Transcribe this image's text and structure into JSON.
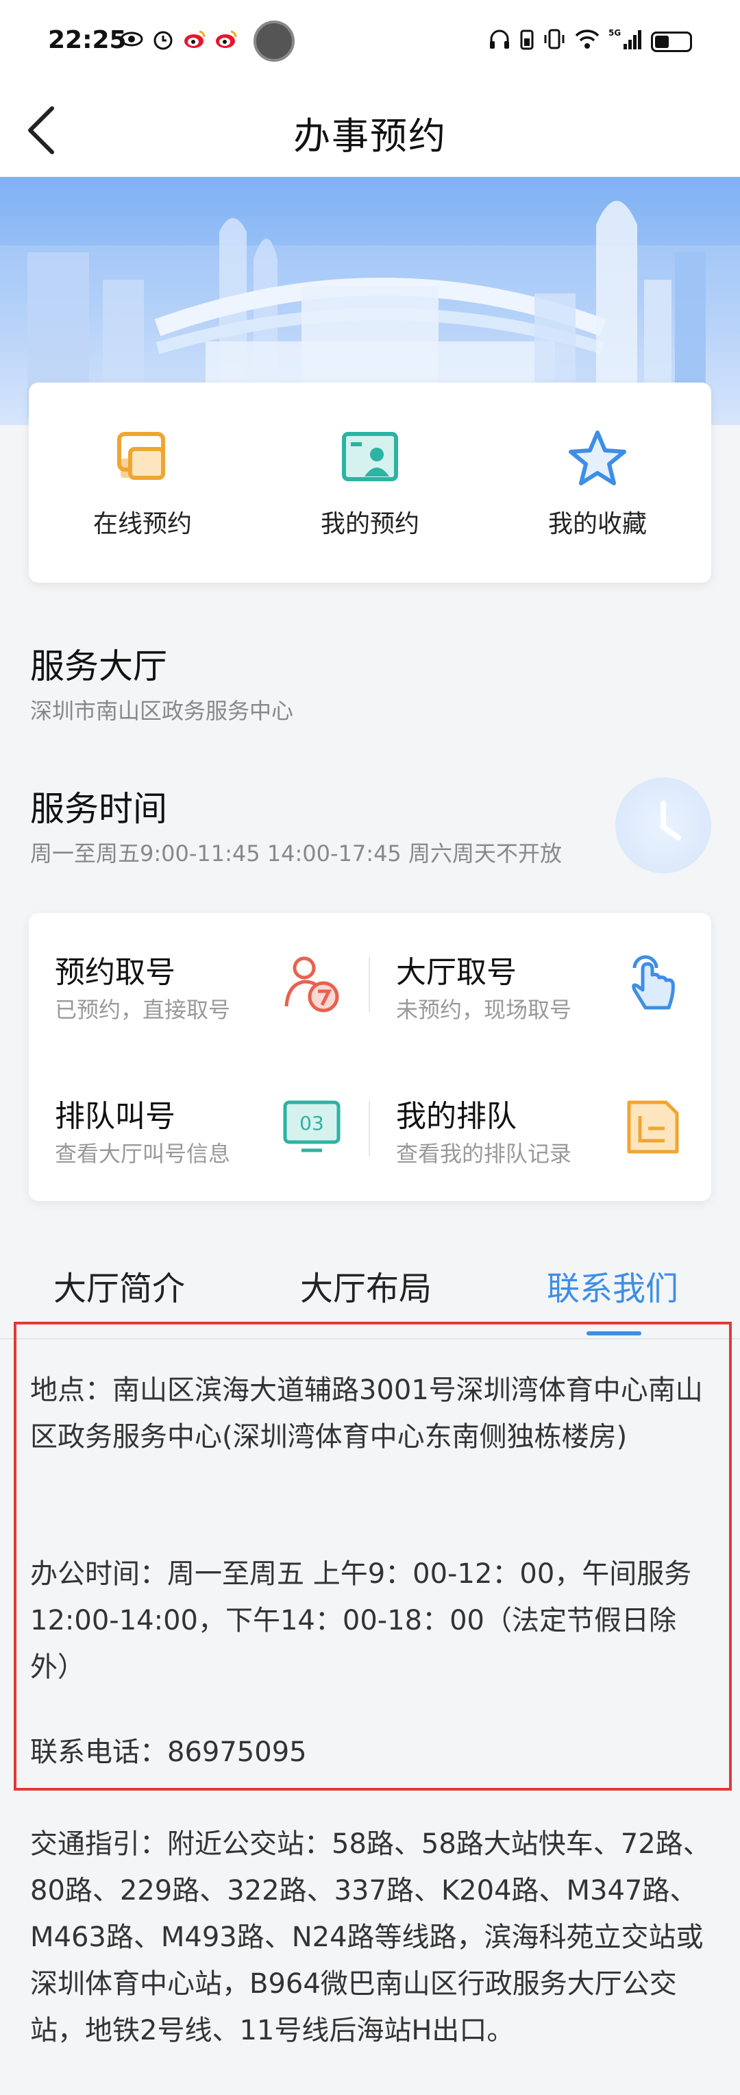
{
  "status_bar": {
    "time": "22:25",
    "left_icons": [
      "eye-icon",
      "alarm-icon",
      "weibo-icon",
      "weibo-icon"
    ],
    "right_icons": [
      "headphones-icon",
      "battery-saver-icon",
      "vibrate-icon",
      "wifi-icon",
      "signal-5g-icon",
      "battery-icon"
    ]
  },
  "nav": {
    "title": "办事预约"
  },
  "quick_actions": [
    {
      "label": "在线预约",
      "icon": "online-booking-icon",
      "color": "#f0a531"
    },
    {
      "label": "我的预约",
      "icon": "my-booking-icon",
      "color": "#2bb3a3"
    },
    {
      "label": "我的收藏",
      "icon": "favorite-star-icon",
      "color": "#3d8ee6"
    }
  ],
  "hall": {
    "title": "服务大厅",
    "name": "深圳市南山区政务服务中心"
  },
  "service_time": {
    "title": "服务时间",
    "hours": "周一至周五9:00-11:45 14:00-17:45 周六周天不开放"
  },
  "queue": [
    {
      "title": "预约取号",
      "sub": "已预约，直接取号",
      "icon": "booked-number-icon",
      "color": "#e8614f"
    },
    {
      "title": "大厅取号",
      "sub": "未预约，现场取号",
      "icon": "tap-hand-icon",
      "color": "#3d8ee6"
    },
    {
      "title": "排队叫号",
      "sub": "查看大厅叫号信息",
      "icon": "queue-screen-icon",
      "icon_text": "03",
      "color": "#2bb3a3"
    },
    {
      "title": "我的排队",
      "sub": "查看我的排队记录",
      "icon": "queue-record-icon",
      "color": "#f0a531"
    }
  ],
  "tabs": [
    {
      "label": "大厅简介",
      "active": false
    },
    {
      "label": "大厅布局",
      "active": false
    },
    {
      "label": "联系我们",
      "active": true
    }
  ],
  "contact": {
    "address": "地点：南山区滨海大道辅路3001号深圳湾体育中心南山区政务服务中心(深圳湾体育中心东南侧独栋楼房)",
    "office_hours": "办公时间：周一至周五 上午9：00-12：00，午间服务12:00-14:00，下午14：00-18：00（法定节假日除外）",
    "phone": "联系电话：86975095",
    "traffic": "交通指引：附近公交站：58路、58路大站快车、72路、80路、229路、322路、337路、K204路、M347路、M463路、M493路、N24路等线路，滨海科苑立交站或深圳体育中心站，B964微巴南山区行政服务大厅公交站，地铁2号线、11号线后海站H出口。"
  }
}
